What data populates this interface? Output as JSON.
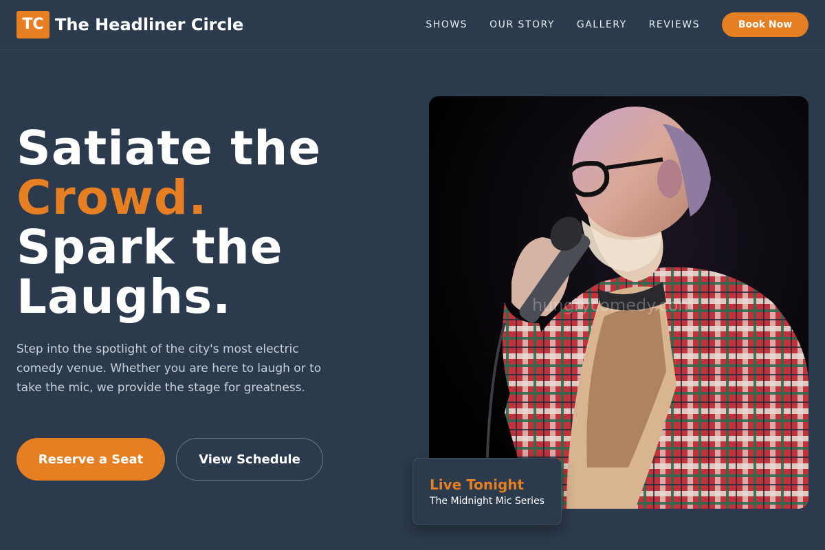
{
  "brand": {
    "badge": "TC",
    "name": "The Headliner Circle"
  },
  "nav": {
    "links": [
      "SHOWS",
      "OUR STORY",
      "GALLERY",
      "REVIEWS"
    ],
    "cta": "Book Now"
  },
  "hero": {
    "title_line1": "Satiate the",
    "title_accent": "Crowd.",
    "title_line3": "Spark the",
    "title_line4": "Laughs.",
    "description": "Step into the spotlight of the city's most electric comedy venue. Whether you are here to laugh or to take the mic, we provide the stage for greatness.",
    "primary_button": "Reserve a Seat",
    "secondary_button": "View Schedule",
    "image_watermark": "hungrycomedy.com"
  },
  "live_card": {
    "title": "Live Tonight",
    "subtitle": "The Midnight Mic Series"
  },
  "colors": {
    "background": "#2c3a4d",
    "accent": "#e67e22",
    "text": "#ffffff"
  }
}
